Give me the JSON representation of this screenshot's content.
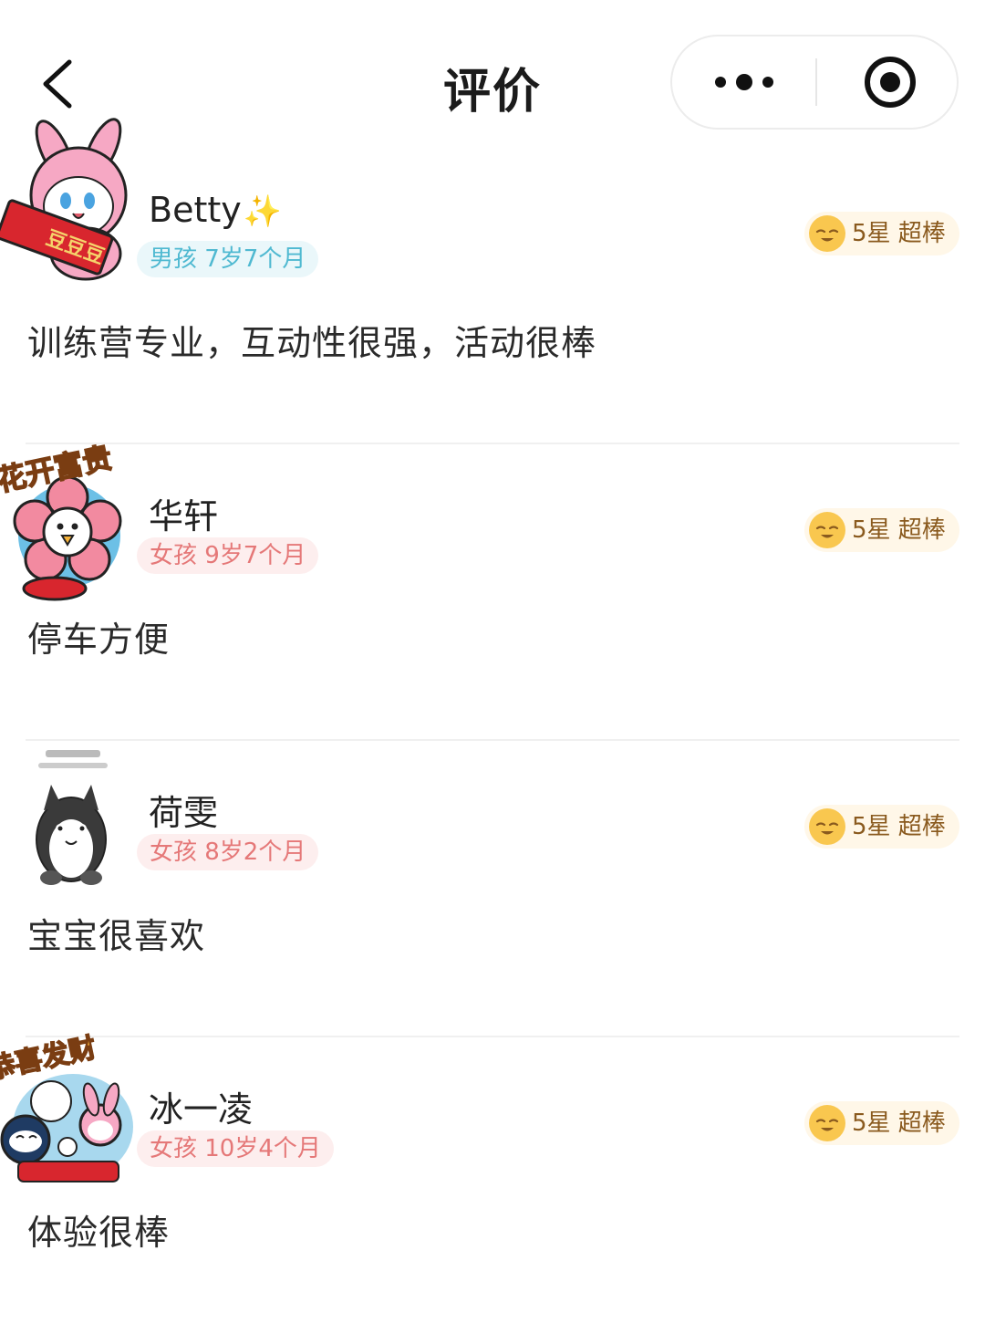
{
  "header": {
    "title": "评价",
    "back_icon": "chevron-left-icon",
    "more_icon": "more-dots-icon",
    "close_icon": "target-circle-icon"
  },
  "reviews": [
    {
      "name": "Betty",
      "name_suffix": "✨",
      "child_tag": "男孩 7岁7个月",
      "gender": "boy",
      "rating": "5星 超棒",
      "content": "训练营专业，互动性很强，活动很棒",
      "avatar": "pink-bunny-sticker"
    },
    {
      "name": "华轩",
      "name_suffix": "",
      "child_tag": "女孩 9岁7个月",
      "gender": "girl",
      "rating": "5星 超棒",
      "content": "停车方便",
      "avatar": "flower-sticker",
      "avatar_caption": "花开富贵"
    },
    {
      "name": "荷雯",
      "name_suffix": "",
      "child_tag": "女孩 8岁2个月",
      "gender": "girl",
      "rating": "5星 超棒",
      "content": "宝宝很喜欢",
      "avatar": "cat-sticker"
    },
    {
      "name": "冰一凌",
      "name_suffix": "",
      "child_tag": "女孩 10岁4个月",
      "gender": "girl",
      "rating": "5星 超棒",
      "content": "体验很棒",
      "avatar": "fortune-sticker",
      "avatar_caption": "恭喜发财"
    }
  ],
  "colors": {
    "boy_tag_text": "#4fb9d1",
    "girl_tag_text": "#e57878",
    "rating_bg": "#fff7e8",
    "rating_text": "#8a5a1e"
  }
}
